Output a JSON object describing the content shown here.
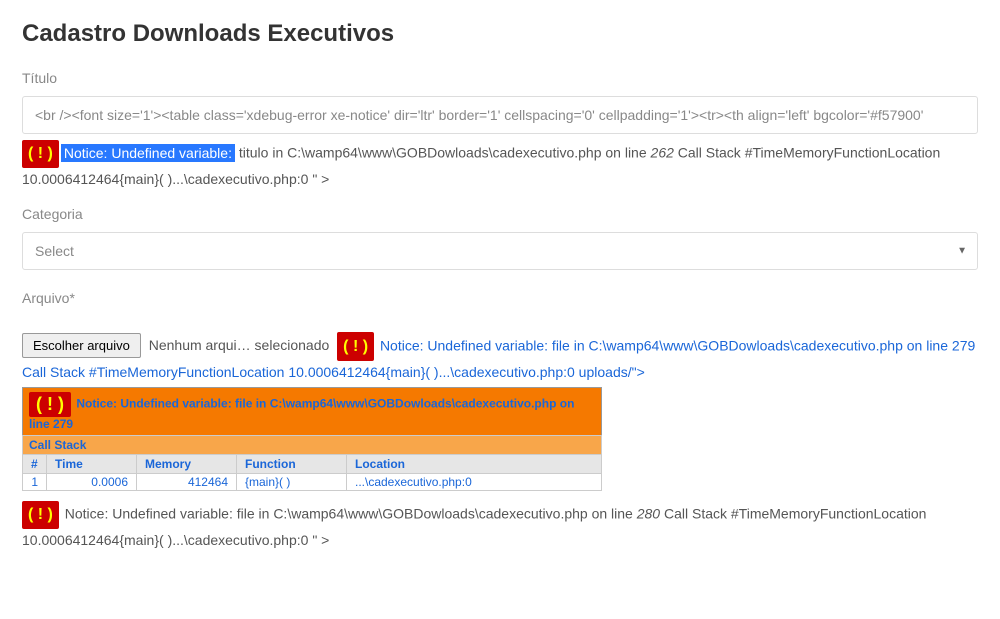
{
  "page": {
    "title": "Cadastro Downloads Executivos"
  },
  "fields": {
    "titulo_label": "Título",
    "titulo_value": "<br /><font size='1'><table class='xdebug-error xe-notice' dir='ltr' border='1' cellspacing='0' cellpadding='1'><tr><th align='left' bgcolor='#f57900'",
    "categoria_label": "Categoria",
    "categoria_selected": "Select",
    "arquivo_label": "Arquivo*",
    "file_button": "Escolher arquivo",
    "file_status": "Nenhum arqui… selecionado"
  },
  "errors": {
    "icon": "( ! )",
    "e1_notice_hl": "Notice: Undefined variable:",
    "e1_rest_a": " titulo in C:\\wamp64\\www\\GOBDowloads\\cadexecutivo.php on line ",
    "e1_line": "262",
    "e1_rest_b": " Call Stack #TimeMemoryFunctionLocation 10.0006412464{main}( )...\\cadexecutivo.php:0 \" >",
    "e2_text_a": "Notice: Undefined variable: file in C:\\wamp64\\www\\GOBDowloads\\cadexecutivo.php on line ",
    "e2_line": "279",
    "e2_text_b": " Call Stack #TimeMemoryFunctionLocation 10.0006412464{main}( )...\\cadexecutivo.php:0 uploads/\">",
    "e3_header": "Notice: Undefined variable: file in C:\\wamp64\\www\\GOBDowloads\\cadexecutivo.php on line ",
    "e3_line": "279",
    "callstack_label": "Call Stack",
    "cols": {
      "num": "#",
      "time": "Time",
      "memory": "Memory",
      "func": "Function",
      "loc": "Location"
    },
    "row": {
      "num": "1",
      "time": "0.0006",
      "memory": "412464",
      "func": "{main}( )",
      "loc": "...\\cadexecutivo.php:0"
    },
    "e4_text_a": "Notice: Undefined variable: file in C:\\wamp64\\www\\GOBDowloads\\cadexecutivo.php on line ",
    "e4_line": "280",
    "e4_text_b": " Call Stack #TimeMemoryFunctionLocation 10.0006412464{main}( )...\\cadexecutivo.php:0 \" >"
  }
}
